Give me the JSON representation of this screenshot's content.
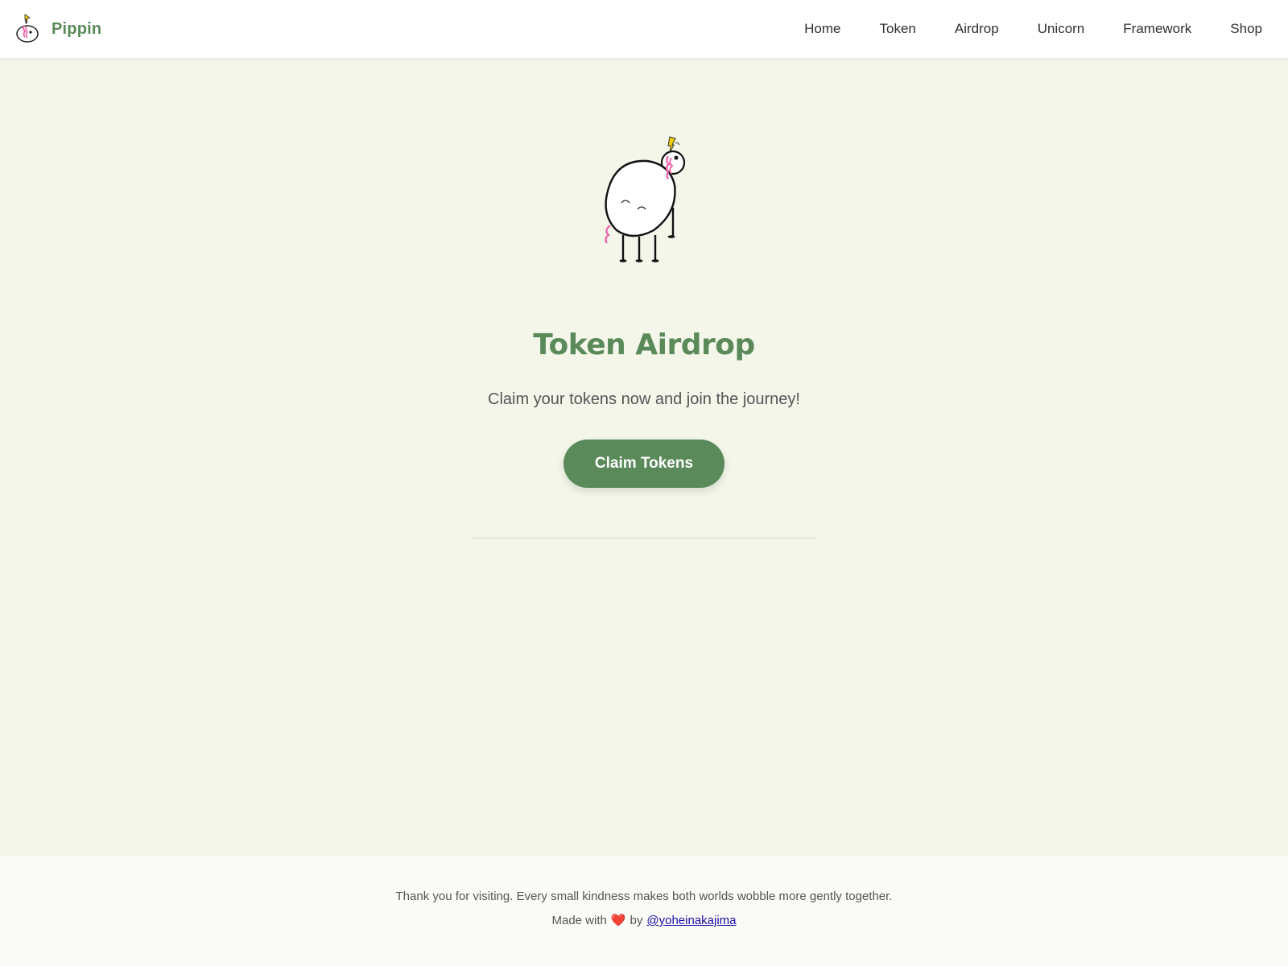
{
  "brand": {
    "name": "Pippin",
    "logo_icon": "pippin-logo-icon"
  },
  "nav": {
    "items": [
      {
        "label": "Home"
      },
      {
        "label": "Token"
      },
      {
        "label": "Airdrop"
      },
      {
        "label": "Unicorn"
      },
      {
        "label": "Framework"
      },
      {
        "label": "Shop"
      }
    ]
  },
  "hero": {
    "mascot_icon": "pippin-unicorn-icon",
    "title": "Token Airdrop",
    "subtitle": "Claim your tokens now and join the journey!",
    "button_label": "Claim Tokens"
  },
  "footer": {
    "message": "Thank you for visiting. Every small kindness makes both worlds wobble more gently together.",
    "made_with": "Made with",
    "heart": "❤️",
    "by": "by",
    "author_link": "@yoheinakajima"
  },
  "colors": {
    "accent": "#5a8a5a",
    "background": "#f4f6ea",
    "header_bg": "#ffffff",
    "footer_bg": "#fafbf6",
    "link": "#1a0dab"
  }
}
